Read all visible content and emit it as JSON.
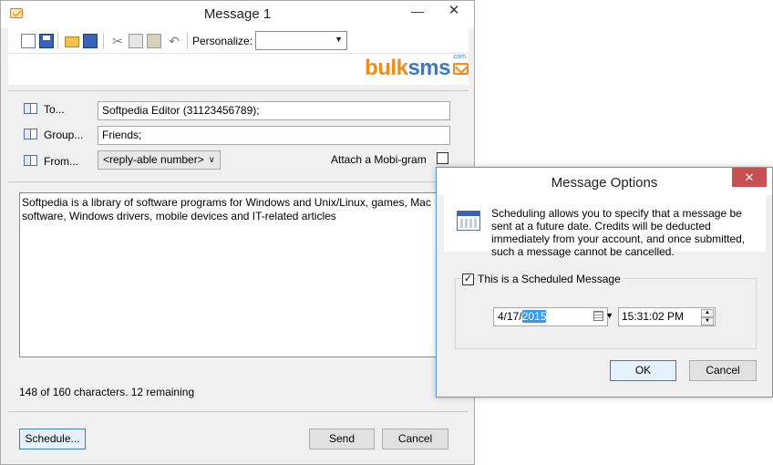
{
  "main_window": {
    "title": "Message 1",
    "min_glyph": "—",
    "close_glyph": "✕",
    "toolbar": {
      "personalize_label": "Personalize:",
      "personalize_value": "",
      "cut_glyph": "✂",
      "undo_glyph": "↶"
    },
    "logo": {
      "part1": "bulk",
      "part2": "sms",
      "dotcom": ".com"
    },
    "fields": {
      "to_label": "To...",
      "to_value": "Softpedia Editor (31123456789);",
      "group_label": "Group...",
      "group_value": "Friends;",
      "from_label": "From...",
      "from_value": "<reply-able number>",
      "mobigram_label": "Attach a Mobi-gram"
    },
    "message_text": "Softpedia is a library of software programs for Windows and Unix/Linux, games, Mac software, Windows drivers, mobile devices and IT-related articles",
    "char_count": "148 of 160 characters.  12 remaining",
    "buttons": {
      "schedule": "Schedule...",
      "send": "Send",
      "cancel": "Cancel"
    }
  },
  "dialog": {
    "title": "Message Options",
    "close_glyph": "✕",
    "info_text": "Scheduling allows you to specify that a message be sent at a future date. Credits will be deducted immediately from your account, and once submitted, such a message cannot be cancelled.",
    "scheduled_label": "This is a Scheduled Message",
    "scheduled_checked": true,
    "check_glyph": "✓",
    "date_prefix": "4/17/",
    "date_selected": "2015",
    "time_value": "15:31:02 PM",
    "buttons": {
      "ok": "OK",
      "cancel": "Cancel"
    }
  },
  "colors": {
    "logo_orange": "#f28b1a",
    "logo_blue": "#3a78c2",
    "dialog_close_red": "#c75050",
    "selection_blue": "#3399ff"
  }
}
